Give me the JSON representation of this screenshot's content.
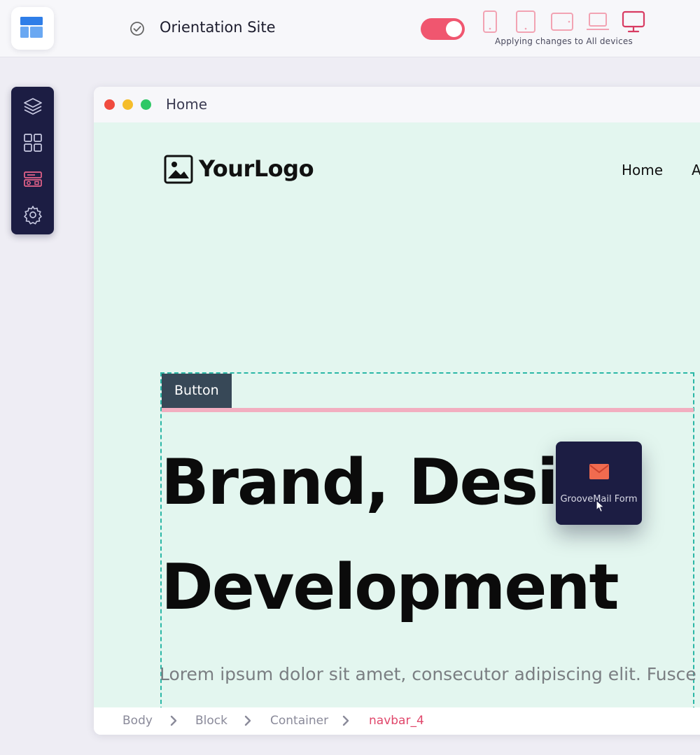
{
  "header": {
    "site_title": "Orientation Site",
    "devices_caption": "Applying changes to All devices",
    "toggle_on": true,
    "colors": {
      "accent": "#f0566f",
      "device_icon": "#f2a3b3",
      "device_active": "#d83b62"
    }
  },
  "toolbar": {
    "icons": [
      "layers-icon",
      "grid-icon",
      "components-icon",
      "settings-icon"
    ]
  },
  "browser": {
    "tab_title": "Home"
  },
  "site": {
    "logo_text": "YourLogo",
    "nav": [
      "Home",
      "A"
    ],
    "button_label": "Button",
    "headline_line1": "Brand, Desig",
    "headline_line1_end": "&",
    "headline_line2": "Development",
    "lorem": "Lorem ipsum dolor sit amet, consecutor adipiscing elit. Fusce"
  },
  "drag": {
    "label": "GrooveMail Form"
  },
  "breadcrumb": {
    "items": [
      "Body",
      "Block",
      "Container",
      "navbar_4"
    ]
  }
}
